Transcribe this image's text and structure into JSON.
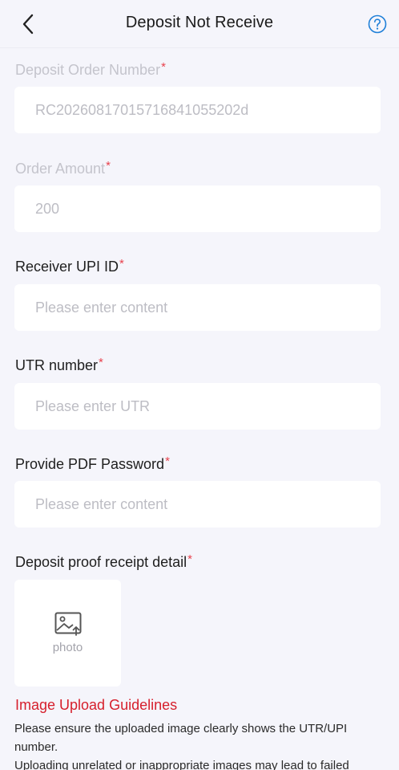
{
  "header": {
    "title": "Deposit Not Receive",
    "back_icon": "chevron-left-icon",
    "help_icon": "question-circle-icon"
  },
  "form": {
    "order_number": {
      "label": "Deposit Order Number",
      "value": "RC2026081701571684105520​2d"
    },
    "order_amount": {
      "label": "Order Amount",
      "value": "200"
    },
    "upi_id": {
      "label": "Receiver UPI ID",
      "placeholder": "Please enter content"
    },
    "utr": {
      "label": "UTR number",
      "placeholder": "Please enter UTR"
    },
    "pdf_password": {
      "label": "Provide PDF Password",
      "placeholder": "Please enter content"
    },
    "receipt": {
      "label": "Deposit proof receipt detail",
      "upload_label": "photo",
      "upload_icon": "image-upload-icon"
    },
    "required_mark": "*"
  },
  "guidelines": {
    "title": "Image Upload Guidelines",
    "line1": "Please ensure the uploaded image clearly shows the UTR/UPI number.",
    "line2": "Uploading unrelated or inappropriate images may lead to failed"
  },
  "colors": {
    "background": "#f5f5fb",
    "field": "#ffffff",
    "required": "#e8424d",
    "guideline_title": "#d61f2c",
    "help_icon": "#1e7fd8"
  }
}
